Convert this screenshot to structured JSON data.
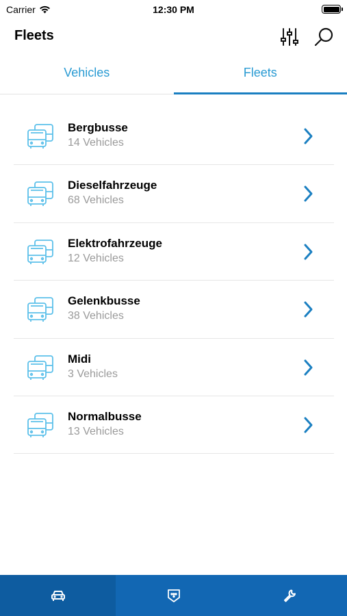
{
  "status_bar": {
    "carrier": "Carrier",
    "time": "12:30 PM"
  },
  "nav": {
    "title": "Fleets",
    "filter_icon": "sliders-icon",
    "search_icon": "search-icon"
  },
  "tabs": [
    {
      "label": "Vehicles",
      "active": false
    },
    {
      "label": "Fleets",
      "active": true
    }
  ],
  "fleets": [
    {
      "name": "Bergbusse",
      "count": "14 Vehicles"
    },
    {
      "name": "Dieselfahrzeuge",
      "count": "68 Vehicles"
    },
    {
      "name": "Elektrofahrzeuge",
      "count": "12 Vehicles"
    },
    {
      "name": "Gelenkbusse",
      "count": "38 Vehicles"
    },
    {
      "name": "Midi",
      "count": "3 Vehicles"
    },
    {
      "name": "Normalbusse",
      "count": "13 Vehicles"
    }
  ],
  "bottom_tabs": [
    {
      "icon": "car-icon",
      "active": true
    },
    {
      "icon": "badge-icon",
      "active": false
    },
    {
      "icon": "wrench-icon",
      "active": false
    }
  ],
  "colors": {
    "accent": "#2a9bd3",
    "tab_indicator": "#1a7fc1",
    "bottom_bar": "#1267b3",
    "chevron": "#1a7fc1",
    "bus_icon": "#5cc0ea"
  }
}
